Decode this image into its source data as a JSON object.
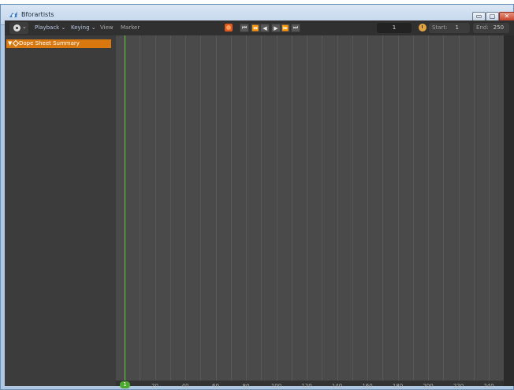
{
  "window": {
    "title": "Bforartists",
    "app_icon": "bforartists-logo-icon",
    "controls": {
      "minimize": "▭",
      "maximize": "▢",
      "close": "✕"
    }
  },
  "header": {
    "editor_type_icon": "timeline-clock-icon",
    "menus": {
      "playback": "Playback",
      "keying": "Keying",
      "view": "View",
      "marker": "Marker"
    },
    "transport": [
      {
        "name": "jump-start-icon",
        "glyph": "⏮"
      },
      {
        "name": "jump-keyframe-back-icon",
        "glyph": "⏪"
      },
      {
        "name": "play-reverse-icon",
        "glyph": "◀"
      },
      {
        "name": "play-icon",
        "glyph": "▶"
      },
      {
        "name": "jump-keyframe-forward-icon",
        "glyph": "⏩"
      },
      {
        "name": "jump-end-icon",
        "glyph": "⏭"
      }
    ],
    "current_frame": "1",
    "start_label": "Start:",
    "start_value": "1",
    "end_label": "End:",
    "end_value": "250"
  },
  "channels": {
    "summary_label": "Dope Sheet Summary"
  },
  "timeline": {
    "current_frame_badge": "1",
    "ruler_ticks": [
      "20",
      "40",
      "60",
      "80",
      "100",
      "120",
      "140",
      "160",
      "180",
      "200",
      "220",
      "240"
    ]
  }
}
